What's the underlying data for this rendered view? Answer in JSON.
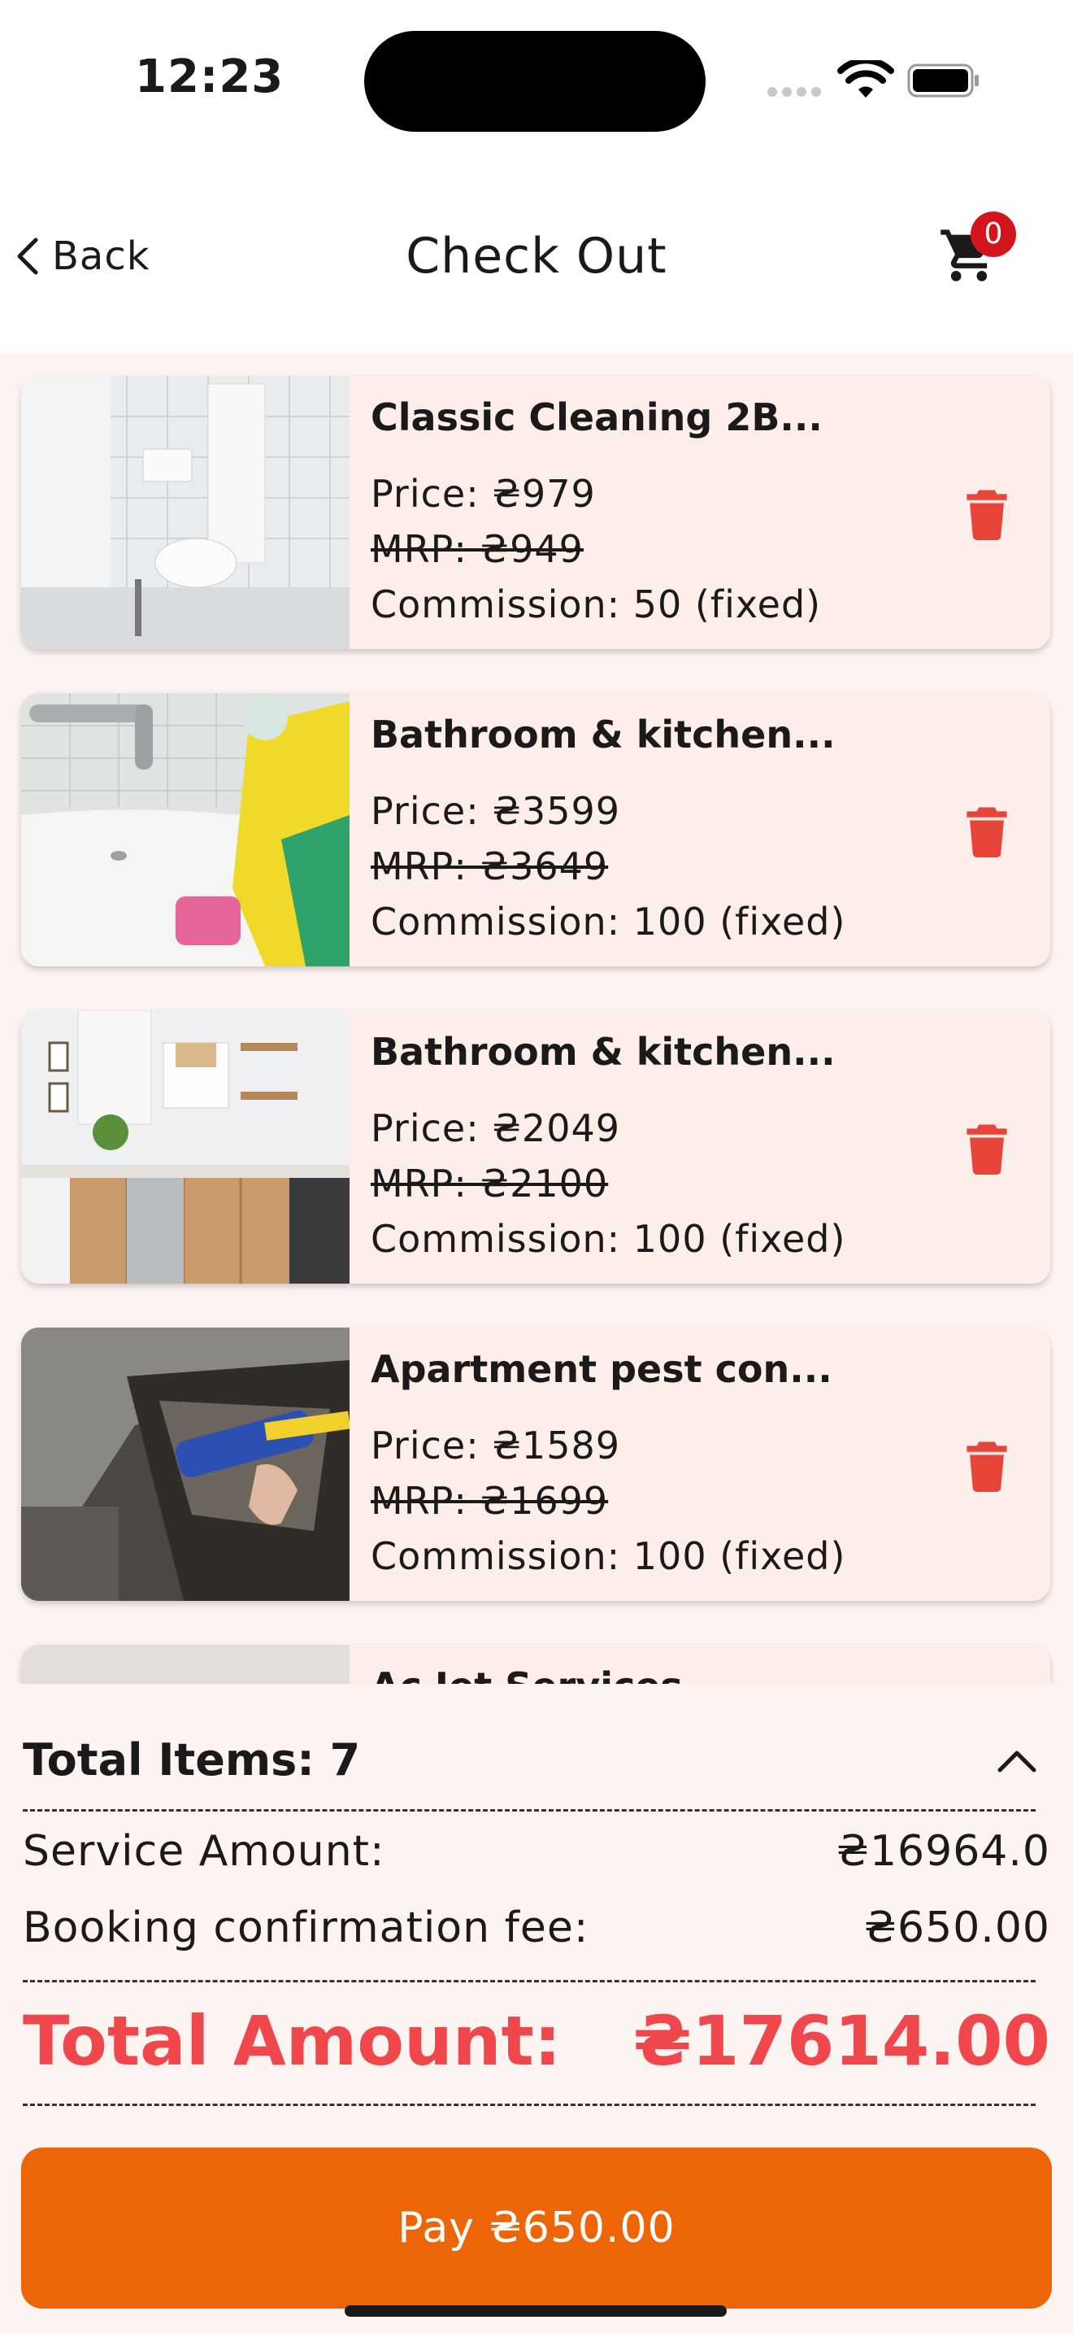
{
  "status_bar": {
    "time": "12:23"
  },
  "header": {
    "back_label": "Back",
    "title": "Check Out",
    "cart_count": "0"
  },
  "items": [
    {
      "title": "Classic Cleaning 2B...",
      "price": "Price: ₴979",
      "mrp": "MRP: ₴949",
      "commission": "Commission: 50 (fixed)"
    },
    {
      "title": "Bathroom & kitchen...",
      "price": "Price: ₴3599",
      "mrp": "MRP: ₴3649",
      "commission": "Commission: 100 (fixed)"
    },
    {
      "title": "Bathroom & kitchen...",
      "price": "Price: ₴2049",
      "mrp": "MRP: ₴2100",
      "commission": "Commission: 100 (fixed)"
    },
    {
      "title": "Apartment pest con...",
      "price": "Price: ₴1589",
      "mrp": "MRP: ₴1699",
      "commission": "Commission: 100 (fixed)"
    },
    {
      "title": "Ac Jet Services"
    }
  ],
  "summary": {
    "total_items": "Total Items: 7",
    "service_amount_label": "Service Amount:",
    "service_amount_value": "₴16964.0",
    "booking_fee_label": "Booking confirmation fee:",
    "booking_fee_value": "₴650.00",
    "total_label": "Total Amount:",
    "total_value": "₴17614.00",
    "pay_label": "Pay ₴650.00"
  },
  "colors": {
    "accent": "#ec6608",
    "total": "#f0474c",
    "trash": "#e8443a",
    "badge": "#d2161c",
    "card": "#fdeee9"
  }
}
